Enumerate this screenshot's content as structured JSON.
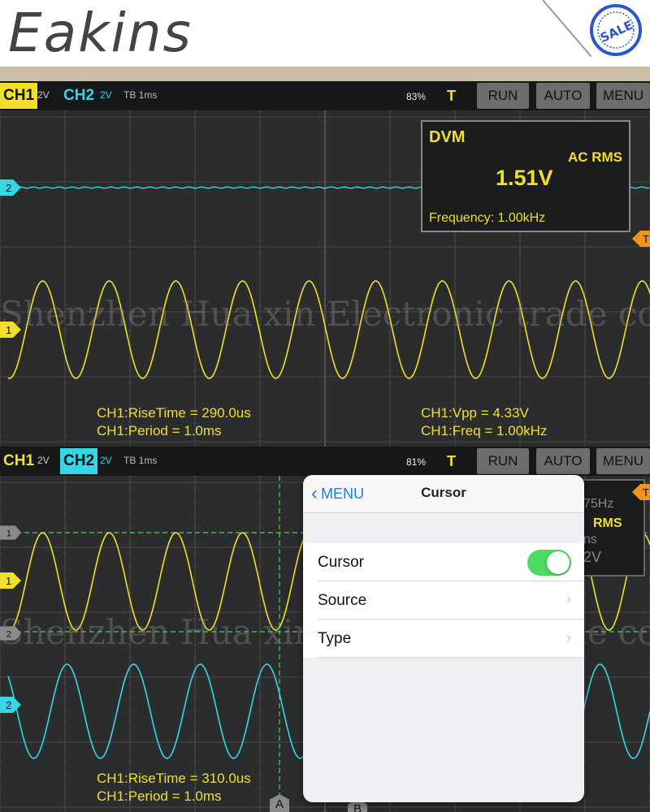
{
  "brand": {
    "name": "Eakins",
    "stamp_text": "SALE"
  },
  "panel_top": {
    "toolbar": {
      "ch1": "CH1",
      "ch1_scale": "2V",
      "ch2": "CH2",
      "ch2_scale": "2V",
      "timebase": "TB 1ms",
      "battery": "83%",
      "trigger": "T",
      "buttons": [
        "RUN",
        "AUTO",
        "MENU"
      ]
    },
    "dvm": {
      "title": "DVM",
      "mode": "AC RMS",
      "value": "1.51V",
      "frequency": "Frequency: 1.00kHz"
    },
    "measurements": {
      "left1": "CH1:RiseTime = 290.0us",
      "left2": "CH1:Period = 1.0ms",
      "right1": "CH1:Vpp = 4.33V",
      "right2": "CH1:Freq = 1.00kHz"
    },
    "markers": {
      "ch2": "2",
      "ch1": "1",
      "trigger": "T"
    },
    "watermark": "Shenzhen Hua xin Electronic trade co., LTD"
  },
  "panel_bottom": {
    "toolbar": {
      "ch1": "CH1",
      "ch1_scale": "2V",
      "ch2": "CH2",
      "ch2_scale": "2V",
      "timebase": "TB 1ms",
      "battery": "81%",
      "trigger": "T",
      "buttons": [
        "RUN",
        "AUTO",
        "MENU"
      ]
    },
    "dvm_partial": {
      "line1": "75Hz",
      "line2": "RMS",
      "line3": "ns",
      "line4": "2V"
    },
    "measurements": {
      "left1": "CH1:RiseTime = 310.0us",
      "left2": "CH1:Period = 1.0ms"
    },
    "markers": {
      "cursor1": "1",
      "cursor2": "2",
      "ch1": "1",
      "ch2": "2",
      "trigger": "T",
      "cursorA": "A",
      "cursorB": "B"
    },
    "watermark": "Shenzhen Hua xin Electronic trade co., LTD"
  },
  "cursor_menu": {
    "back_label": "MENU",
    "title": "Cursor",
    "rows": [
      {
        "label": "Cursor",
        "toggle_on": true
      },
      {
        "label": "Source"
      },
      {
        "label": "Type"
      }
    ]
  },
  "colors": {
    "ch1": "#f0e02a",
    "ch2": "#35d6e6",
    "accent": "#1a7cf5",
    "toggle_on": "#4cd964"
  }
}
